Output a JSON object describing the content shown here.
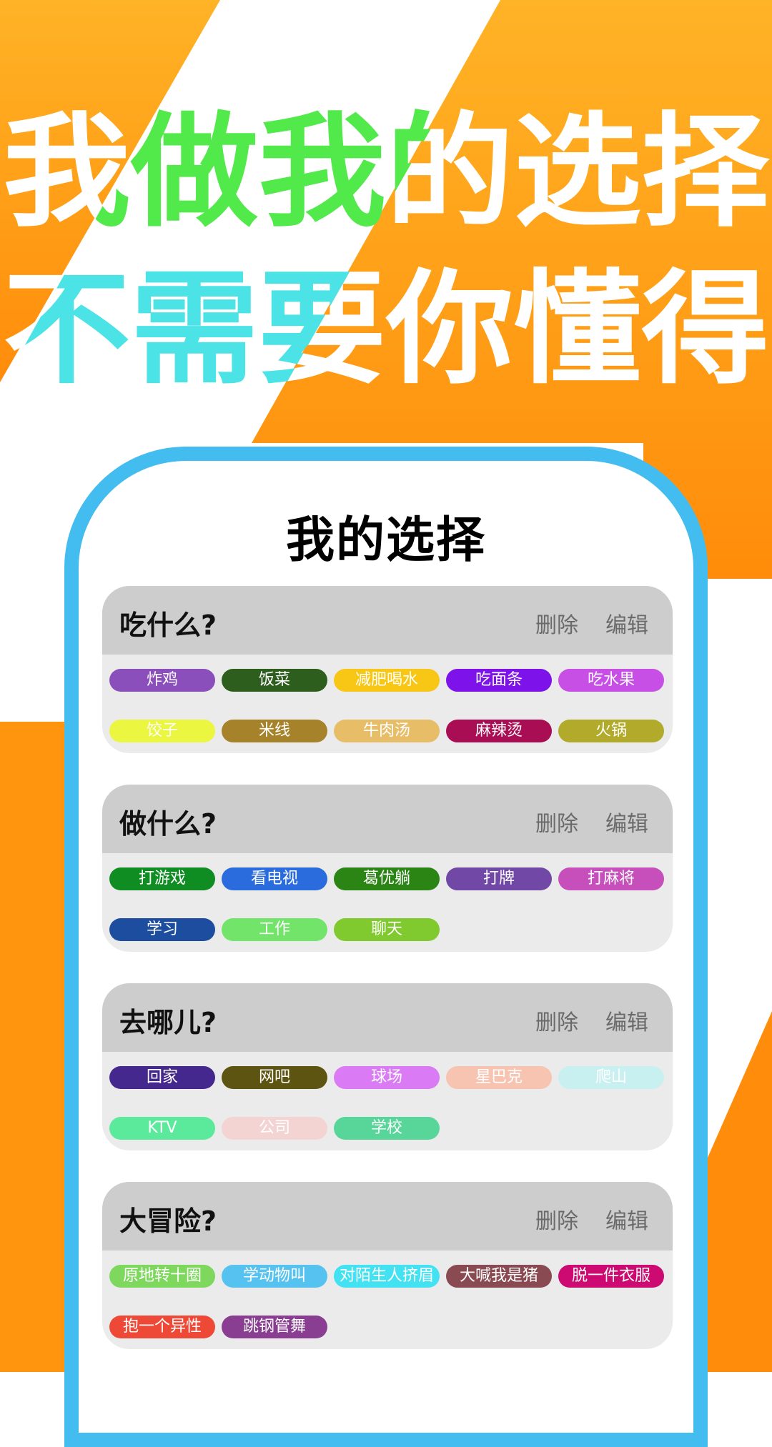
{
  "banner": {
    "line1": "我做我的选择",
    "line2": "不需要你懂得",
    "colors": {
      "orange_top": "#FFB326",
      "orange_bottom": "#FF8C0A",
      "white": "#FFFFFF",
      "line1_highlight": "#52E94B",
      "line2_highlight": "#4BE3E6",
      "phone_border": "#43BCEF"
    }
  },
  "app": {
    "title": "我的选择",
    "delete_label": "删除",
    "edit_label": "编辑",
    "cards": [
      {
        "title": "吃什么?",
        "options": [
          {
            "label": "炸鸡",
            "color": "#8A4FBB"
          },
          {
            "label": "饭菜",
            "color": "#2E5E1E"
          },
          {
            "label": "减肥喝水",
            "color": "#F8C614"
          },
          {
            "label": "吃面条",
            "color": "#7E12EA"
          },
          {
            "label": "吃水果",
            "color": "#C84FE6"
          },
          {
            "label": "饺子",
            "color": "#EAF63F"
          },
          {
            "label": "米线",
            "color": "#A6822A"
          },
          {
            "label": "牛肉汤",
            "color": "#E8BD68"
          },
          {
            "label": "麻辣烫",
            "color": "#A90E55"
          },
          {
            "label": "火锅",
            "color": "#B1AA2A"
          }
        ]
      },
      {
        "title": "做什么?",
        "options": [
          {
            "label": "打游戏",
            "color": "#0F8C22"
          },
          {
            "label": "看电视",
            "color": "#2A6CDD"
          },
          {
            "label": "葛优躺",
            "color": "#2A8514"
          },
          {
            "label": "打牌",
            "color": "#7248A6"
          },
          {
            "label": "打麻将",
            "color": "#C64FBC"
          },
          {
            "label": "学习",
            "color": "#1C4D9E"
          },
          {
            "label": "工作",
            "color": "#72E46A"
          },
          {
            "label": "聊天",
            "color": "#80C92E"
          }
        ]
      },
      {
        "title": "去哪儿?",
        "options": [
          {
            "label": "回家",
            "color": "#45288E"
          },
          {
            "label": "网吧",
            "color": "#5E5412"
          },
          {
            "label": "球场",
            "color": "#DA7AF5"
          },
          {
            "label": "星巴克",
            "color": "#F8C4B2"
          },
          {
            "label": "爬山",
            "color": "#C8F0F1"
          },
          {
            "label": "KTV",
            "color": "#5BEA9C"
          },
          {
            "label": "公司",
            "color": "#F4D4D2"
          },
          {
            "label": "学校",
            "color": "#58D69A"
          }
        ]
      },
      {
        "title": "大冒险?",
        "options": [
          {
            "label": "原地转十圈",
            "color": "#7ED85E"
          },
          {
            "label": "学动物叫",
            "color": "#55C2F0"
          },
          {
            "label": "对陌生人挤眉",
            "color": "#42E2F2"
          },
          {
            "label": "大喊我是猪",
            "color": "#8A4A52"
          },
          {
            "label": "脱一件衣服",
            "color": "#CC0A72"
          },
          {
            "label": "抱一个异性",
            "color": "#EE4836"
          },
          {
            "label": "跳钢管舞",
            "color": "#8A3E92"
          }
        ]
      }
    ]
  }
}
